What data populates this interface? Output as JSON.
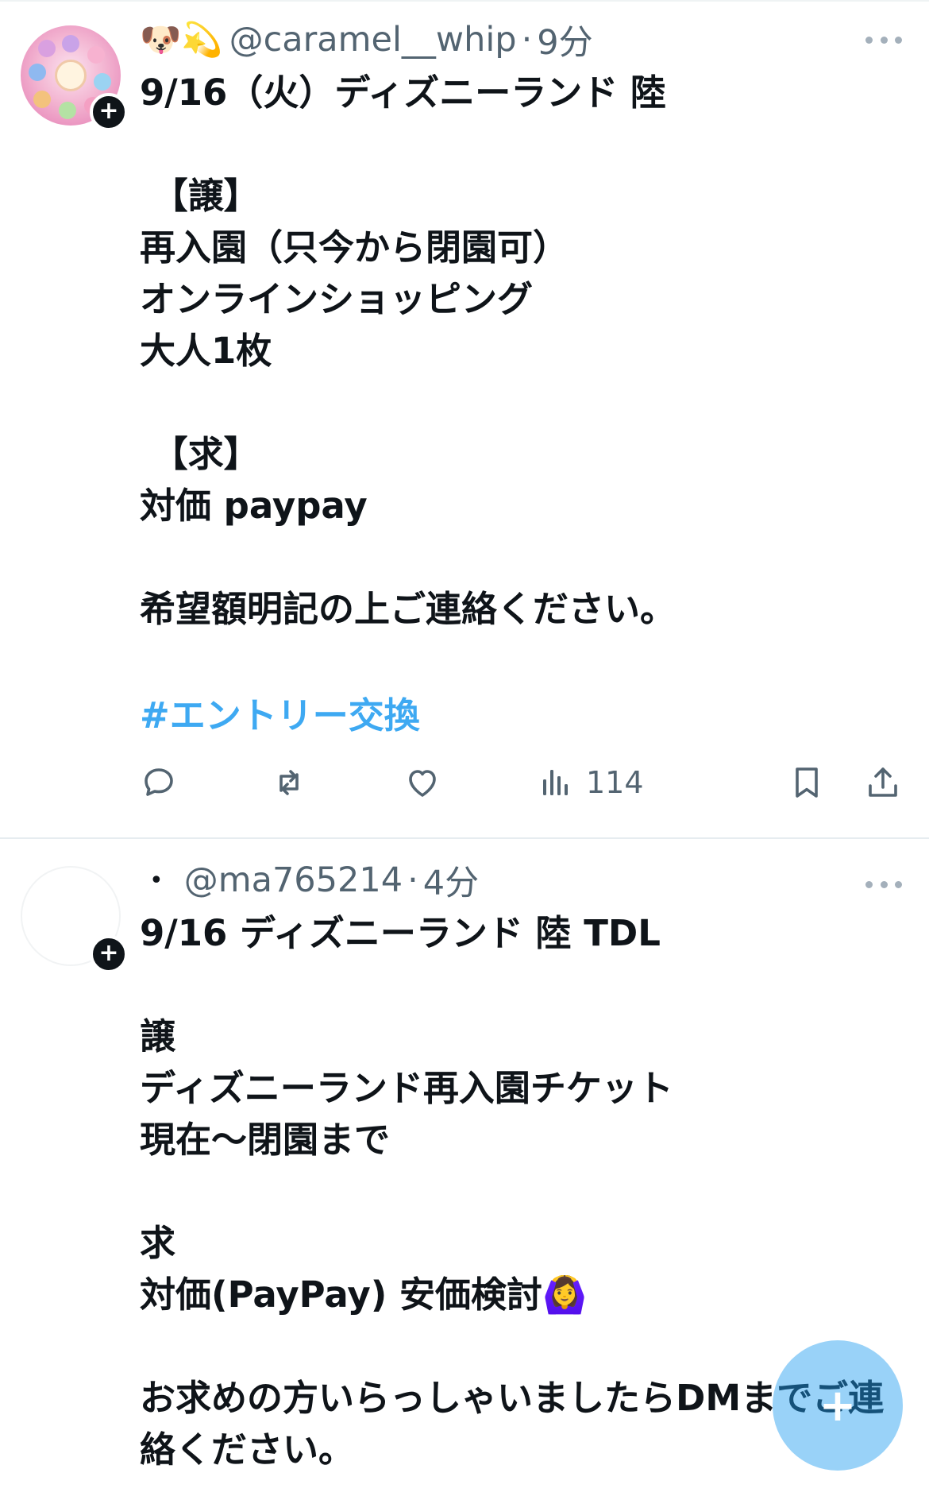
{
  "feed": {
    "tweets": [
      {
        "avatar_icon": "avatar-image",
        "emojis": "🐶💫",
        "handle": "@caramel__whip",
        "separator": "·",
        "time": "9分",
        "body": "9/16（火）ディズニーランド 陸\n\n 【譲】\n再入園（只今から閉園可）\nオンラインショッピング\n大人1枚\n\n 【求】\n対価 paypay\n\n希望額明記の上ご連絡ください。",
        "hashtag": "#エントリー交換",
        "views": "114"
      },
      {
        "avatar_icon": "avatar-image",
        "bullet": "•",
        "handle": "@ma765214",
        "separator": "·",
        "time": "4分",
        "body": "9/16 ディズニーランド 陸 TDL\n\n譲\nディズニーランド再入園チケット\n現在〜閉園まで\n\n求\n対価(PayPay) 安価検討🙆‍♀️\n\nお求めの方いらっしゃいましたらDMまでご連絡ください。"
      }
    ]
  },
  "actions": {
    "reply_icon": "reply-icon",
    "retweet_icon": "retweet-icon",
    "like_icon": "heart-icon",
    "views_icon": "views-icon",
    "bookmark_icon": "bookmark-icon",
    "share_icon": "share-icon"
  },
  "compose_fab": {
    "symbol": "+"
  },
  "colors": {
    "text": "#0f1419",
    "secondary": "#536471",
    "link": "#1d9bf0",
    "fab": "#1d9bf0"
  }
}
